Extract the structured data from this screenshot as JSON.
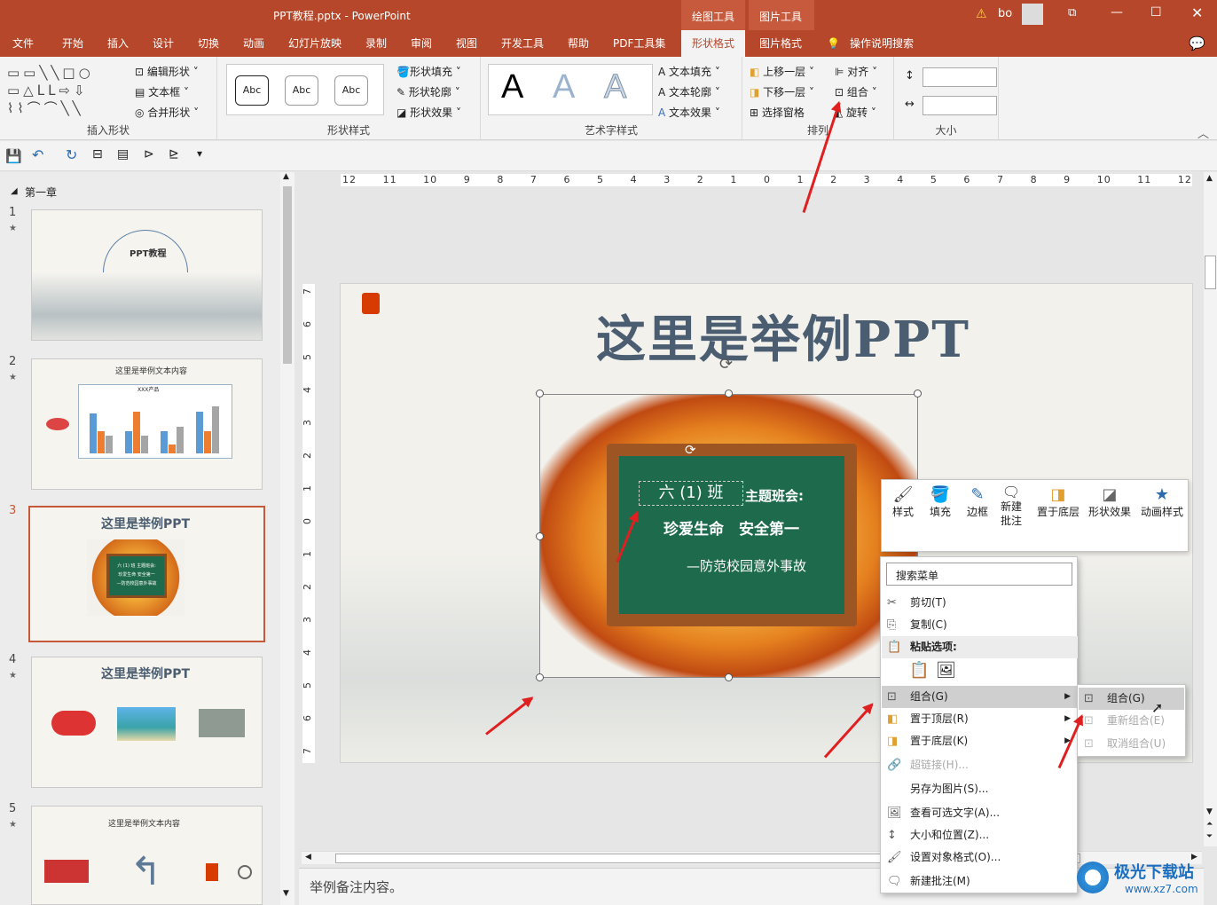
{
  "window": {
    "title": "PPT教程.pptx  -  PowerPoint",
    "ctx_draw": "绘图工具",
    "ctx_pic": "图片工具",
    "user": "bo"
  },
  "menu": {
    "tabs": [
      "文件",
      "开始",
      "插入",
      "设计",
      "切换",
      "动画",
      "幻灯片放映",
      "录制",
      "审阅",
      "视图",
      "开发工具",
      "帮助",
      "PDF工具集"
    ],
    "active": "形状格式",
    "pic_format": "图片格式",
    "tell_me": "操作说明搜索"
  },
  "ribbon": {
    "insert_shapes": {
      "label": "插入形状",
      "edit_shape": "编辑形状",
      "text_box": "文本框",
      "merge_shapes": "合并形状"
    },
    "shape_styles": {
      "label": "形状样式",
      "abc": "Abc",
      "fill": "形状填充",
      "outline": "形状轮廓",
      "effect": "形状效果"
    },
    "wordart": {
      "label": "艺术字样式",
      "a": "A",
      "text_fill": "文本填充",
      "text_outline": "文本轮廓",
      "text_effect": "文本效果"
    },
    "arrange": {
      "label": "排列",
      "bring_forward": "上移一层",
      "send_backward": "下移一层",
      "selection_pane": "选择窗格",
      "align": "对齐",
      "group": "组合",
      "rotate": "旋转"
    },
    "size": {
      "label": "大小"
    }
  },
  "thumbs": {
    "section": "第一章",
    "s1_title": "PPT教程",
    "s2_title": "这里是举例文本内容",
    "s2_chart": "XXX产品",
    "s3_title": "这里是举例PPT",
    "s3_l1": "六 (1) 班  主题班会:",
    "s3_l2": "珍爱生命  安全第一",
    "s3_l3": "—防范校园意外事故",
    "s4_title": "这里是举例PPT",
    "s5_title": "这里是举例文本内容",
    "nums": [
      "1",
      "2",
      "3",
      "4",
      "5"
    ],
    "star": "★"
  },
  "ruler": {
    "h": [
      "12",
      "11",
      "10",
      "9",
      "8",
      "7",
      "6",
      "5",
      "4",
      "3",
      "2",
      "1",
      "0",
      "1",
      "2",
      "3",
      "4",
      "5",
      "6",
      "7",
      "8",
      "9",
      "10",
      "11",
      "12"
    ],
    "v": [
      "7",
      "6",
      "5",
      "4",
      "3",
      "2",
      "1",
      "0",
      "1",
      "2",
      "3",
      "4",
      "5",
      "6",
      "7"
    ]
  },
  "slide": {
    "title": "这里是举例PPT",
    "board_l1": "六 (1) 班",
    "board_l1b": "主题班会:",
    "board_l2": "珍爱生命　安全第一",
    "board_l3": "—防范校园意外事故"
  },
  "mini_toolbar": [
    "样式",
    "填充",
    "边框",
    "新建\n批注",
    "置于底层",
    "形状效果",
    "动画样式"
  ],
  "context_menu": {
    "search": "搜索菜单",
    "items": [
      "剪切(T)",
      "复制(C)",
      "粘贴选项:",
      "组合(G)",
      "置于顶层(R)",
      "置于底层(K)",
      "超链接(H)...",
      "另存为图片(S)...",
      "查看可选文字(A)...",
      "大小和位置(Z)...",
      "设置对象格式(O)...",
      "新建批注(M)"
    ]
  },
  "submenu": [
    "组合(G)",
    "重新组合(E)",
    "取消组合(U)"
  ],
  "notes": "举例备注内容。",
  "watermark": {
    "brand": "极光下载站",
    "url": "www.xz7.com"
  },
  "colors": {
    "accent": "#b7472a",
    "board": "#1e6a4c",
    "arrow": "#e02020"
  }
}
